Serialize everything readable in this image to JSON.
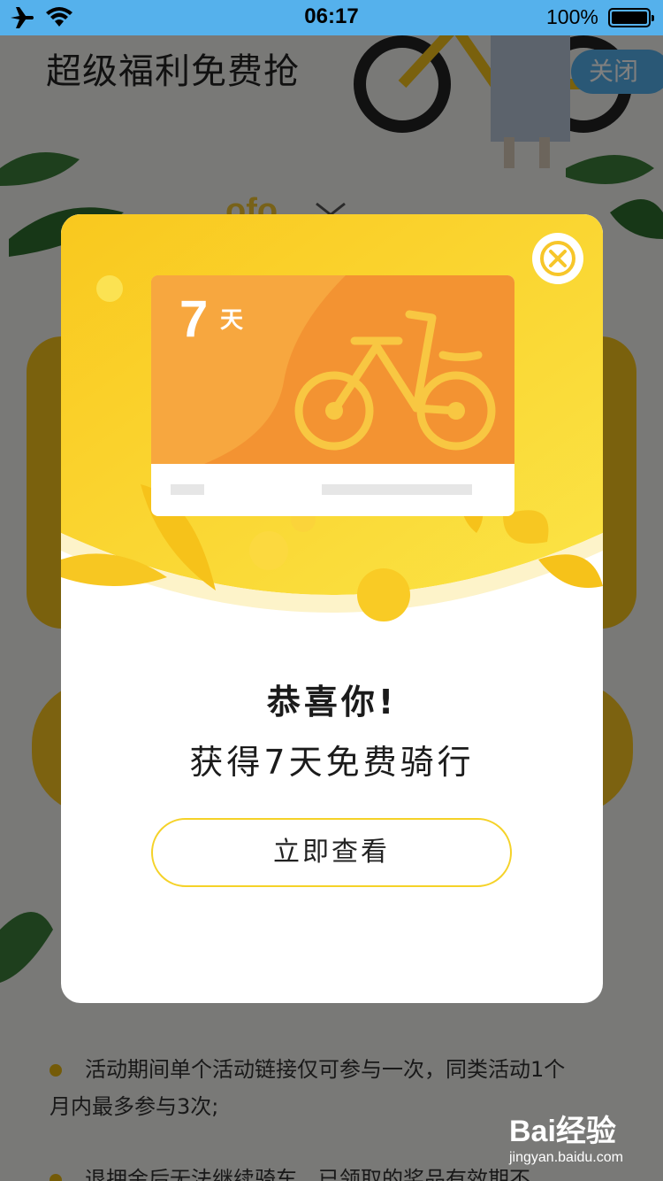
{
  "status_bar": {
    "time": "06:17",
    "battery_text": "100%",
    "battery_level": 1.0
  },
  "background_page": {
    "title": "超级福利免费抢",
    "close_label": "关闭",
    "rules": [
      "活动期间单个活动链接仅可参与一次，同类活动1个",
      "月内最多参与3次;",
      "退押金后无法继续骑车，已领取的奖品有效期不"
    ]
  },
  "modal": {
    "card_days": "7",
    "card_days_unit": "天",
    "congrats": "恭喜你!",
    "reward_text": "获得7天免费骑行",
    "view_button": "立即查看"
  },
  "watermark": {
    "logo": "Bai经验",
    "url": "jingyan.baidu.com"
  },
  "colors": {
    "status_bar": "#55b1ec",
    "card_orange": "#f39332",
    "hero_yellow": "#f9d233",
    "button_border": "#f5d228"
  }
}
